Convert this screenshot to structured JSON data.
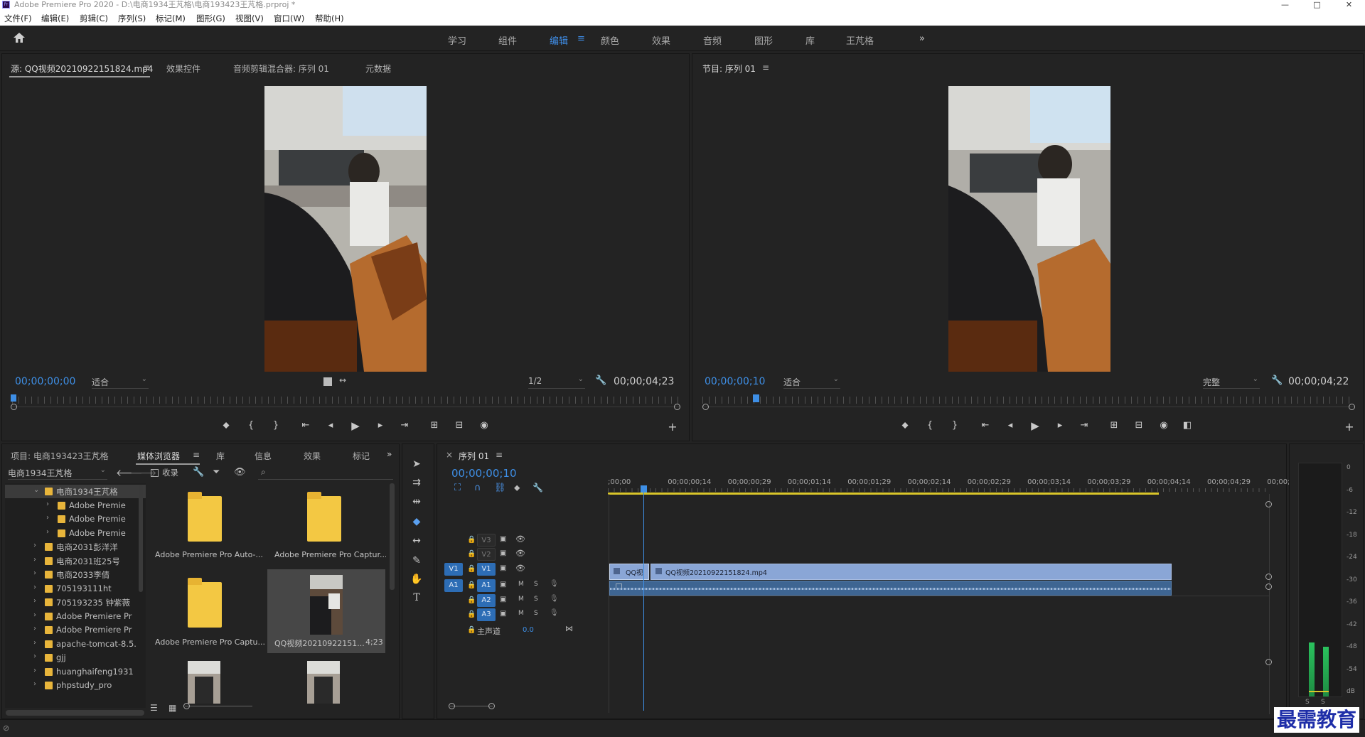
{
  "window": {
    "title": "Adobe Premiere Pro 2020 - D:\\电商1934王芃格\\电商193423王芃格.prproj *",
    "app_icon": "Pr",
    "controls": [
      "—",
      "□",
      "✕"
    ]
  },
  "menu": [
    "文件(F)",
    "编辑(E)",
    "剪辑(C)",
    "序列(S)",
    "标记(M)",
    "图形(G)",
    "视图(V)",
    "窗口(W)",
    "帮助(H)"
  ],
  "workspaces": {
    "items": [
      "学习",
      "组件",
      "编辑",
      "颜色",
      "效果",
      "音频",
      "图形",
      "库",
      "王芃格"
    ],
    "active": "编辑",
    "more": "»"
  },
  "source_panel": {
    "tabs": [
      "源: QQ视频20210922151824.mp4",
      "效果控件",
      "音频剪辑混合器: 序列 01",
      "元数据"
    ],
    "timecode": "00;00;00;00",
    "fit": "适合",
    "resolution": "1/2",
    "duration": "00;00;04;23",
    "playhead_fraction": 0.0
  },
  "program_panel": {
    "tab": "节目: 序列 01",
    "timecode": "00;00;00;10",
    "fit": "适合",
    "quality": "完整",
    "duration": "00;00;04;22",
    "playhead_fraction": 0.08
  },
  "project_panel": {
    "tabs": [
      "项目: 电商193423王芃格",
      "媒体浏览器",
      "库",
      "信息",
      "效果",
      "标记"
    ],
    "active_tab": "媒体浏览器",
    "location": "电商1934王芃格",
    "ingest_label": "收录",
    "tree": [
      {
        "label": "电商1934王芃格",
        "indent": 0,
        "expanded": true,
        "selected": true
      },
      {
        "label": "Adobe Premie",
        "indent": 1
      },
      {
        "label": "Adobe Premie",
        "indent": 1
      },
      {
        "label": "Adobe Premie",
        "indent": 1
      },
      {
        "label": "电商2031彭洋洋",
        "indent": 0
      },
      {
        "label": "电商2031班25号",
        "indent": 0
      },
      {
        "label": "电商2033李倩",
        "indent": 0
      },
      {
        "label": "705193111ht",
        "indent": 0
      },
      {
        "label": "705193235 钟紫薇",
        "indent": 0
      },
      {
        "label": "Adobe Premiere Pr",
        "indent": 0
      },
      {
        "label": "Adobe Premiere Pr",
        "indent": 0
      },
      {
        "label": "apache-tomcat-8.5.",
        "indent": 0
      },
      {
        "label": "gjj",
        "indent": 0
      },
      {
        "label": "huanghaifeng1931",
        "indent": 0
      },
      {
        "label": "phpstudy_pro",
        "indent": 0
      }
    ],
    "items": [
      {
        "label": "Adobe Premiere Pro Auto-...",
        "kind": "folder"
      },
      {
        "label": "Adobe Premiere Pro Captur...",
        "kind": "folder"
      },
      {
        "label": "Adobe Premiere Pro Captu...",
        "kind": "folder"
      },
      {
        "label": "QQ视频20210922151...",
        "kind": "video",
        "duration": "4;23"
      }
    ]
  },
  "timeline": {
    "tab": "序列 01",
    "timecode": "00;00;00;10",
    "ruler": [
      ";00;00",
      "00;00;00;14",
      "00;00;00;29",
      "00;00;01;14",
      "00;00;01;29",
      "00;00;02;14",
      "00;00;02;29",
      "00;00;03;14",
      "00;00;03;29",
      "00;00;04;14",
      "00;00;04;29",
      "00;00;0"
    ],
    "video_tracks": [
      "V3",
      "V2",
      "V1"
    ],
    "audio_tracks": [
      "A1",
      "A2",
      "A3"
    ],
    "source_v": "V1",
    "source_a": "A1",
    "master_label": "主声道",
    "master_value": "0.0",
    "clip_short": "QQ视",
    "clip_name": "QQ视频20210922151824.mp4",
    "mute": "M",
    "solo": "S"
  },
  "meter": {
    "labels": [
      "0",
      "-6",
      "-12",
      "-18",
      "-24",
      "-30",
      "-36",
      "-42",
      "-48",
      "-54",
      "dB"
    ],
    "solo_labels": [
      "S",
      "S"
    ]
  },
  "watermark": "最需教育",
  "colors": {
    "accent": "#3f8ee8",
    "clip_video": "#8aa6d6",
    "clip_audio": "#3e6592",
    "work_area": "#d9c52a"
  }
}
